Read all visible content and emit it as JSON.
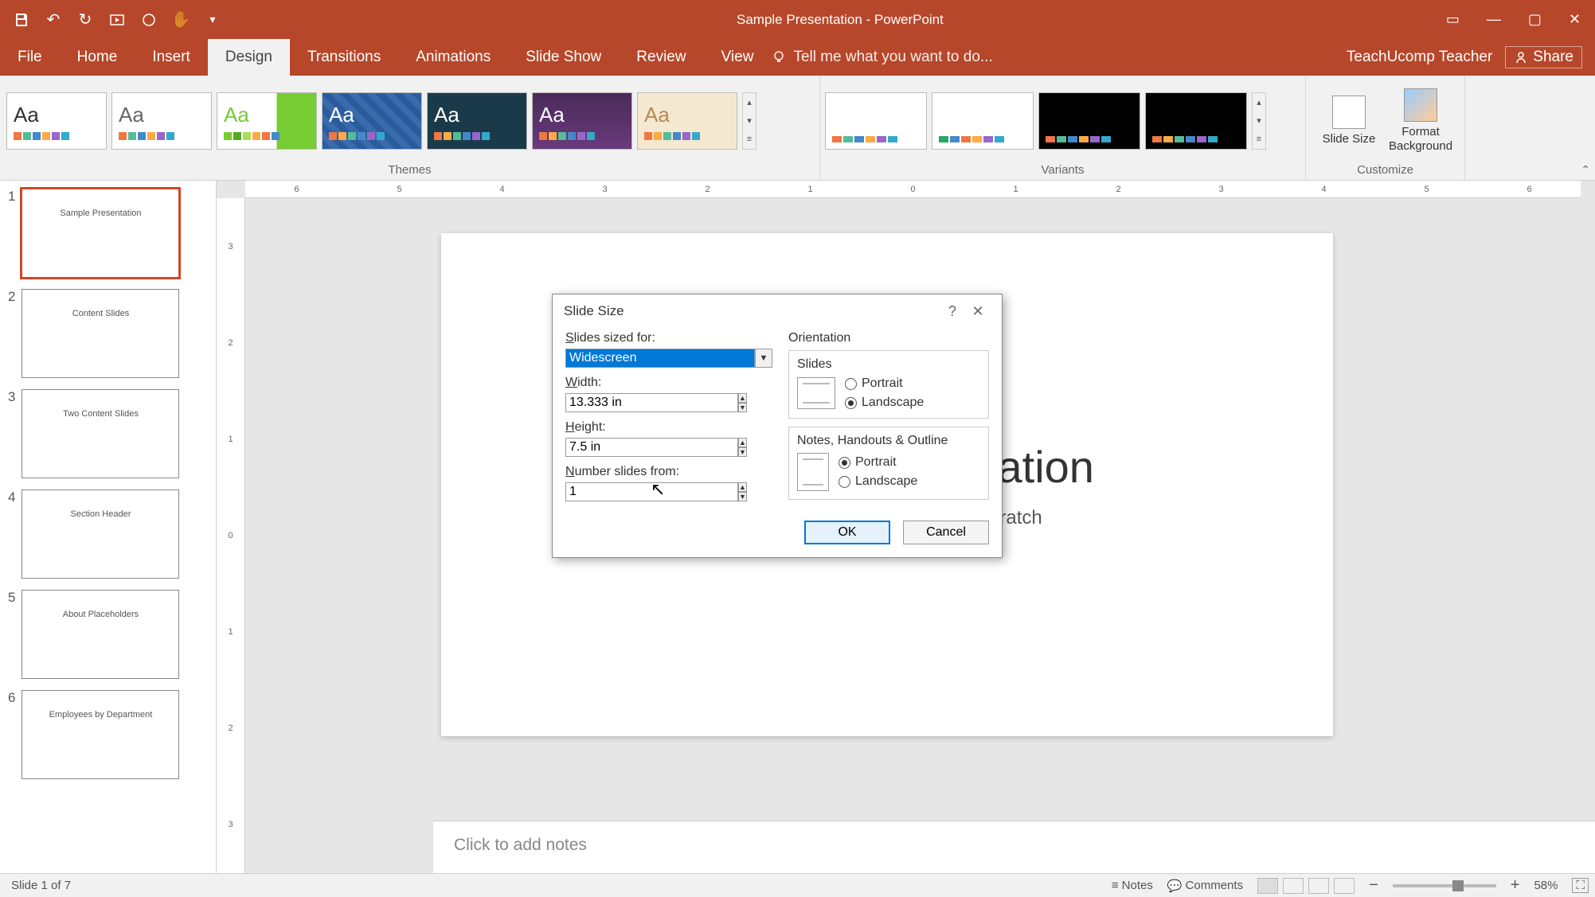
{
  "app": {
    "title": "Sample Presentation - PowerPoint",
    "user": "TeachUcomp Teacher",
    "share": "Share"
  },
  "tabs": {
    "file": "File",
    "home": "Home",
    "insert": "Insert",
    "design": "Design",
    "transitions": "Transitions",
    "animations": "Animations",
    "slideshow": "Slide Show",
    "review": "Review",
    "view": "View",
    "tellme": "Tell me what you want to do..."
  },
  "groups": {
    "themes": "Themes",
    "variants": "Variants",
    "customize": "Customize",
    "slide_size": "Slide\nSize",
    "format_bg": "Format\nBackground"
  },
  "slide": {
    "title": "Sample Presentation",
    "subtitle": "Building a Presentation from Scratch"
  },
  "thumbs": [
    {
      "n": "1",
      "t": "Sample Presentation"
    },
    {
      "n": "2",
      "t": "Content Slides"
    },
    {
      "n": "3",
      "t": "Two Content Slides"
    },
    {
      "n": "4",
      "t": "Section Header"
    },
    {
      "n": "5",
      "t": "About Placeholders"
    },
    {
      "n": "6",
      "t": "Employees by Department"
    }
  ],
  "notes_placeholder": "Click to add notes",
  "ruler_h": [
    "6",
    "5",
    "4",
    "3",
    "2",
    "1",
    "0",
    "1",
    "2",
    "3",
    "4",
    "5",
    "6"
  ],
  "ruler_v": [
    "3",
    "2",
    "1",
    "0",
    "1",
    "2",
    "3"
  ],
  "status": {
    "left": "Slide 1 of 7",
    "notes": "Notes",
    "comments": "Comments",
    "zoom": "58%"
  },
  "dialog": {
    "title": "Slide Size",
    "labels": {
      "sized_for": "Slides sized for:",
      "width": "Width:",
      "height": "Height:",
      "number_from": "Number slides from:",
      "orientation": "Orientation",
      "slides": "Slides",
      "notes": "Notes, Handouts & Outline",
      "portrait": "Portrait",
      "landscape": "Landscape",
      "ok": "OK",
      "cancel": "Cancel"
    },
    "values": {
      "sized_for": "Widescreen",
      "width": "13.333 in",
      "height": "7.5 in",
      "number_from": "1"
    }
  }
}
